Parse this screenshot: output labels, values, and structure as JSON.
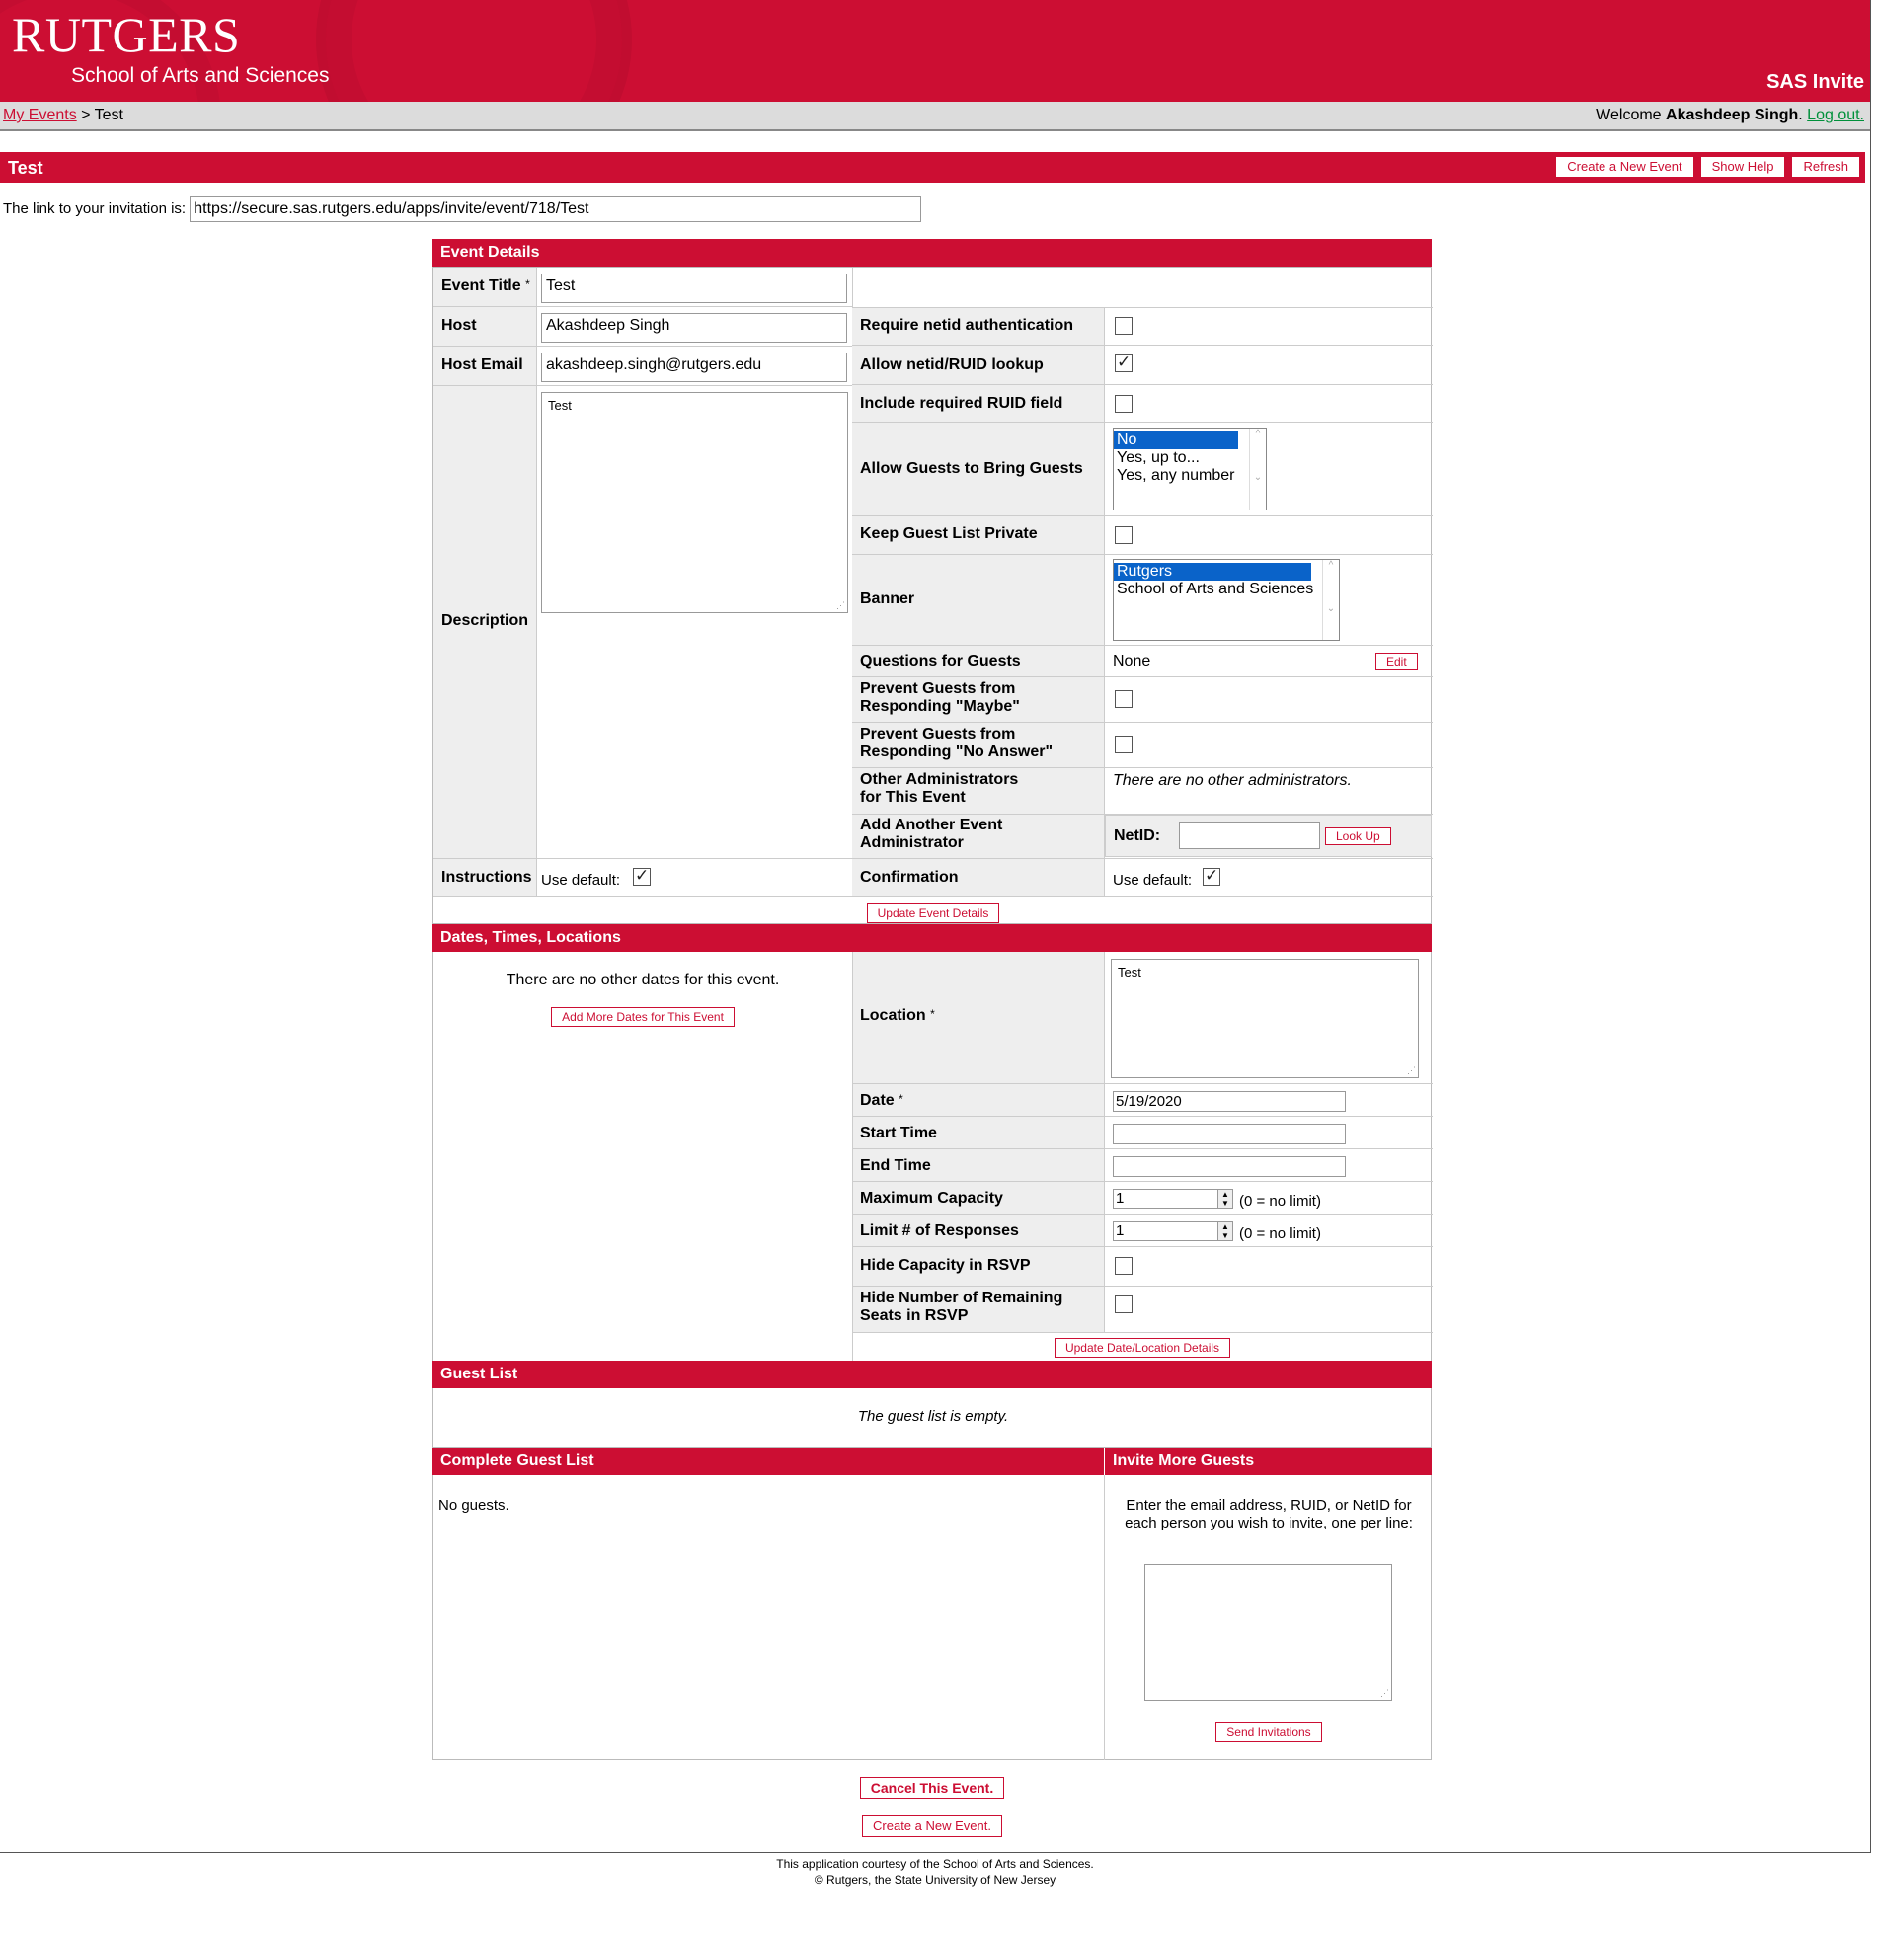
{
  "header": {
    "logo_text": "RUTGERS",
    "logo_subtitle": "School of Arts and Sciences",
    "app_name": "SAS Invite"
  },
  "breadcrumb": {
    "parent_link": "My Events",
    "separator": ">",
    "current": "Test",
    "welcome_prefix": "Welcome",
    "user_name": "Akashdeep Singh",
    "period": ".",
    "logout": "Log out."
  },
  "titlebar": {
    "title": "Test",
    "buttons": [
      "Create a New Event",
      "Show Help",
      "Refresh"
    ]
  },
  "invitation_link": {
    "label": "The link to your invitation is:",
    "url": "https://secure.sas.rutgers.edu/apps/invite/event/718/Test"
  },
  "event_details": {
    "heading": "Event Details",
    "event_title_label": "Event Title",
    "required_mark": "*",
    "event_title_value": "Test",
    "host_label": "Host",
    "host_value": "Akashdeep Singh",
    "host_email_label": "Host Email",
    "host_email_value": "akashdeep.singh@rutgers.edu",
    "description_label": "Description",
    "description_value": "Test",
    "require_netid_label": "Require netid authentication",
    "require_netid_checked": false,
    "allow_lookup_label": "Allow netid/RUID lookup",
    "allow_lookup_checked": true,
    "include_ruid_label": "Include required RUID field",
    "include_ruid_checked": false,
    "bring_guests_label": "Allow Guests to Bring Guests",
    "bring_guests_options": [
      "No",
      "Yes, up to...",
      "Yes, any number"
    ],
    "bring_guests_selected": "No",
    "keep_private_label": "Keep Guest List Private",
    "keep_private_checked": false,
    "banner_label": "Banner",
    "banner_options": [
      "Rutgers",
      "School of Arts and Sciences"
    ],
    "banner_selected": "Rutgers",
    "questions_label": "Questions for Guests",
    "questions_value": "None",
    "questions_edit": "Edit",
    "prevent_maybe_label": "Prevent Guests from Responding \"Maybe\"",
    "prevent_maybe_checked": false,
    "prevent_noanswer_label": "Prevent Guests from Responding \"No Answer\"",
    "prevent_noanswer_checked": false,
    "other_admins_label": "Other Administrators for This Event",
    "other_admins_value": "There are no other administrators.",
    "add_admin_label": "Add Another Event Administrator",
    "netid_label": "NetID:",
    "netid_value": "",
    "lookup_button": "Look Up",
    "instructions_label": "Instructions",
    "use_default_label": "Use default:",
    "instructions_default_checked": true,
    "confirmation_label": "Confirmation",
    "confirmation_default_checked": true,
    "update_button": "Update Event Details"
  },
  "dates": {
    "heading": "Dates, Times, Locations",
    "no_other_dates": "There are no other dates for this event.",
    "add_dates_button": "Add More Dates for This Event",
    "location_label": "Location",
    "location_value": "Test",
    "date_label": "Date",
    "date_value": "5/19/2020",
    "start_time_label": "Start Time",
    "start_time_value": "",
    "end_time_label": "End Time",
    "end_time_value": "",
    "max_capacity_label": "Maximum Capacity",
    "max_capacity_value": "1",
    "no_limit_hint": "(0 = no limit)",
    "limit_responses_label": "Limit # of Responses",
    "limit_responses_value": "1",
    "hide_capacity_label": "Hide Capacity in RSVP",
    "hide_capacity_checked": false,
    "hide_remaining_label": "Hide Number of Remaining Seats in RSVP",
    "hide_remaining_checked": false,
    "update_button": "Update Date/Location Details"
  },
  "guest_list": {
    "heading": "Guest List",
    "empty_text": "The guest list is empty."
  },
  "complete_list": {
    "heading": "Complete Guest List",
    "text": "No guests."
  },
  "invite_more": {
    "heading": "Invite More Guests",
    "instructions": "Enter the email address, RUID, or NetID for each person you wish to invite, one per line:",
    "textarea_value": "",
    "send_button": "Send Invitations"
  },
  "actions": {
    "cancel_event": "Cancel This Event.",
    "create_event": "Create a New Event."
  },
  "footer": {
    "line1": "This application courtesy of the School of Arts and Sciences.",
    "line2": "© Rutgers, the State University of New Jersey"
  },
  "colors": {
    "brand_red": "#cc0e33",
    "label_bg": "#eeeeee",
    "link_green": "#00903a",
    "selection_blue": "#0a63c9"
  }
}
